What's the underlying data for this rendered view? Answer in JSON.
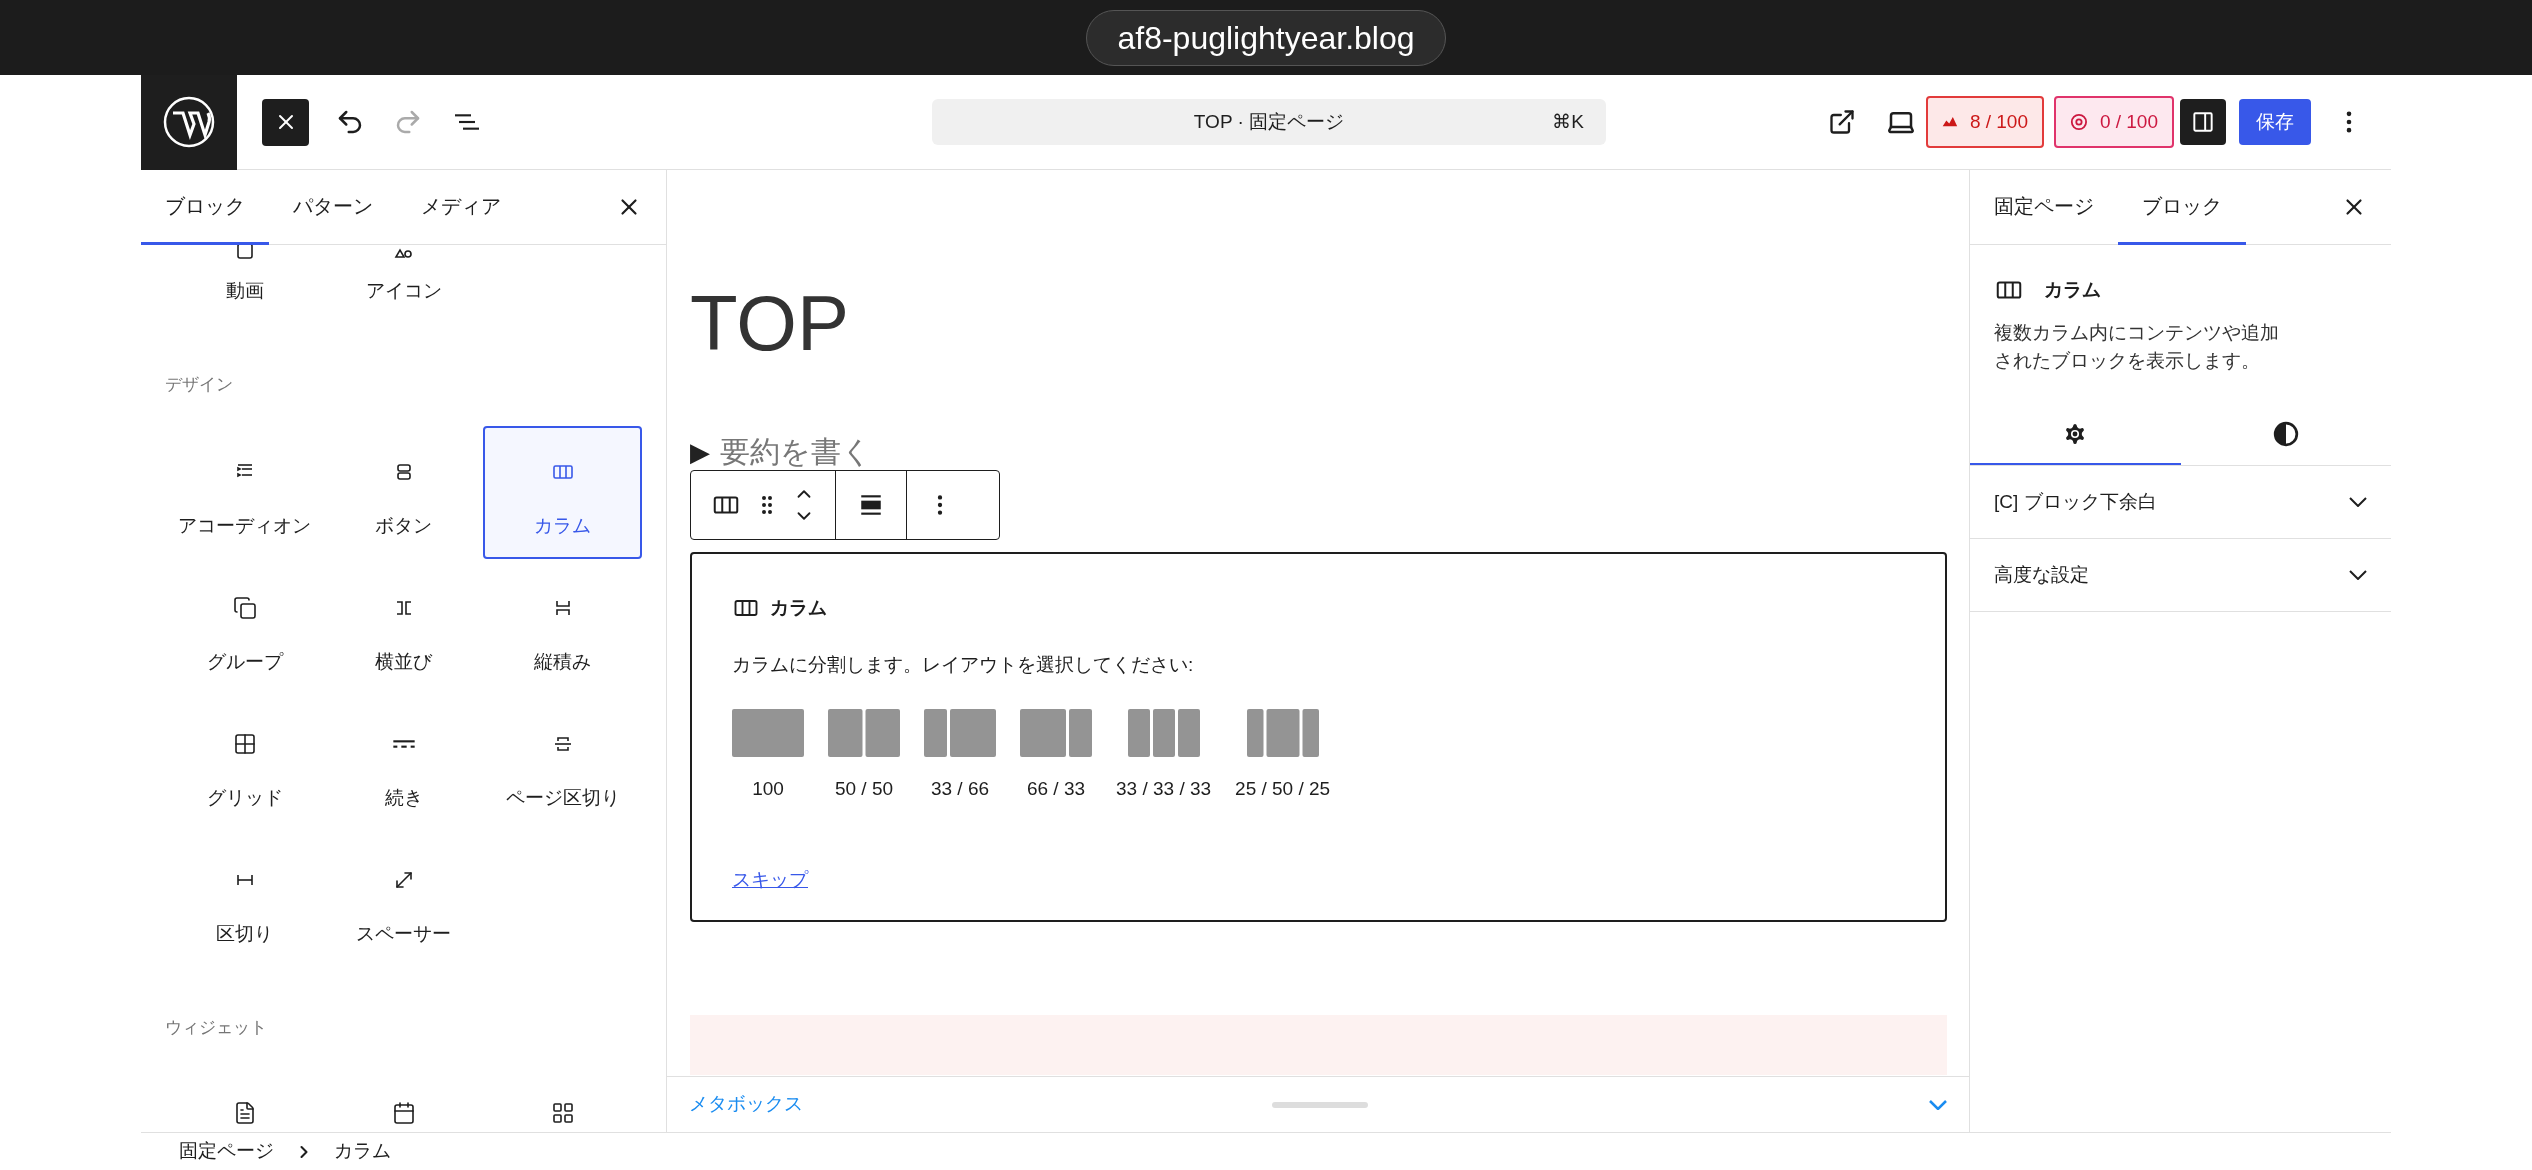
{
  "browser": {
    "url": "af8-puglightyear.blog"
  },
  "header": {
    "command_bar": {
      "title": "TOP · 固定ページ",
      "shortcut": "⌘K"
    },
    "badges": [
      {
        "kind": "speed",
        "value": "8 / 100"
      },
      {
        "kind": "access",
        "value": "0 / 100"
      }
    ],
    "sidebar_toggle": {
      "on": true
    },
    "save_button": "保存"
  },
  "inserter": {
    "tabs": [
      {
        "label": "ブロック",
        "selected": true
      },
      {
        "label": "パターン",
        "selected": false
      },
      {
        "label": "メディア",
        "selected": false
      }
    ],
    "sections": [
      {
        "items": [
          {
            "label": "動画",
            "selected": false
          },
          {
            "label": "アイコン",
            "selected": false
          }
        ]
      },
      {
        "heading": "デザイン",
        "items": [
          {
            "label": "アコーディオン",
            "selected": false
          },
          {
            "label": "ボタン",
            "selected": false
          },
          {
            "label": "カラム",
            "selected": true
          },
          {
            "label": "グループ",
            "selected": false
          },
          {
            "label": "横並び",
            "selected": false
          },
          {
            "label": "縦積み",
            "selected": false
          },
          {
            "label": "グリッド",
            "selected": false
          },
          {
            "label": "続き",
            "selected": false
          },
          {
            "label": "ページ区切り",
            "selected": false
          },
          {
            "label": "区切り",
            "selected": false
          },
          {
            "label": "スペーサー",
            "selected": false
          }
        ]
      },
      {
        "heading": "ウィジェット"
      }
    ]
  },
  "editor": {
    "title": "TOP",
    "summary_marker": "▶",
    "summary": "要約を書く",
    "placeholder": {
      "title": "カラム",
      "instruction": "カラムに分割します。レイアウトを選択してください:",
      "layouts": [
        {
          "label": "100"
        },
        {
          "label": "50 / 50"
        },
        {
          "label": "33 / 66"
        },
        {
          "label": "66 / 33"
        },
        {
          "label": "33 / 33 / 33"
        },
        {
          "label": "25 / 50 / 25"
        }
      ],
      "skip_link": "スキップ"
    },
    "metabox": {
      "label": "メタボックス"
    }
  },
  "settings": {
    "tabs": [
      {
        "label": "固定ページ",
        "selected": false
      },
      {
        "label": "ブロック",
        "selected": true
      }
    ],
    "block": {
      "name": "カラム",
      "description": "複数カラム内にコンテンツや追加されたブロックを表示します。"
    },
    "icon_tabs": [
      {
        "kind": "settings",
        "selected": true
      },
      {
        "kind": "styles",
        "selected": false
      }
    ],
    "panels": [
      {
        "label": "[C] ブロック下余白"
      },
      {
        "label": "高度な設定"
      }
    ]
  },
  "breadcrumb": [
    "固定ページ",
    "カラム"
  ]
}
